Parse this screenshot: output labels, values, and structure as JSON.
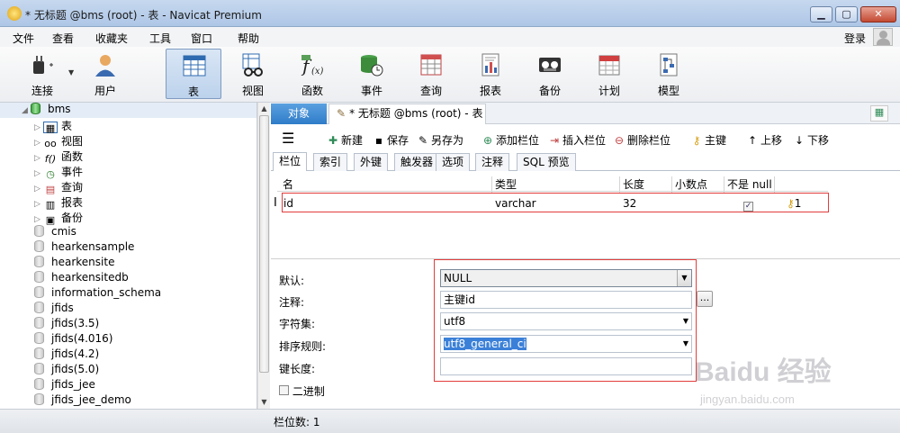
{
  "window": {
    "title": "* 无标题 @bms (root) - 表 - Navicat Premium"
  },
  "menu": {
    "items": [
      "文件",
      "查看",
      "收藏夹",
      "工具",
      "窗口",
      "帮助"
    ],
    "login": "登录"
  },
  "toolbar": {
    "buttons": [
      {
        "label": "连接",
        "icon": "plug-icon"
      },
      {
        "label": "用户",
        "icon": "user-icon"
      },
      {
        "label": "表",
        "icon": "table-icon",
        "selected": true
      },
      {
        "label": "视图",
        "icon": "view-icon"
      },
      {
        "label": "函数",
        "icon": "function-icon"
      },
      {
        "label": "事件",
        "icon": "event-icon"
      },
      {
        "label": "查询",
        "icon": "query-icon"
      },
      {
        "label": "报表",
        "icon": "report-icon"
      },
      {
        "label": "备份",
        "icon": "backup-icon"
      },
      {
        "label": "计划",
        "icon": "schedule-icon"
      },
      {
        "label": "模型",
        "icon": "model-icon"
      }
    ]
  },
  "tree": {
    "open_db": "bms",
    "children": [
      "表",
      "视图",
      "函数",
      "事件",
      "查询",
      "报表",
      "备份"
    ],
    "databases": [
      "cmis",
      "hearkensample",
      "hearkensite",
      "hearkensitedb",
      "information_schema",
      "jfids",
      "jfids(3.5)",
      "jfids(4.016)",
      "jfids(4.2)",
      "jfids(5.0)",
      "jfids_jee",
      "jfids_jee_demo"
    ]
  },
  "tabs": {
    "object": "对象",
    "doc": "* 无标题 @bms (root) - 表"
  },
  "editor_toolbar": {
    "new": "新建",
    "save": "保存",
    "save_as": "另存为",
    "add_field": "添加栏位",
    "insert_field": "插入栏位",
    "delete_field": "删除栏位",
    "primary_key": "主键",
    "move_up": "上移",
    "move_down": "下移"
  },
  "subtabs": [
    "栏位",
    "索引",
    "外键",
    "触发器",
    "选项",
    "注释",
    "SQL 预览"
  ],
  "grid": {
    "headers": [
      "名",
      "类型",
      "长度",
      "小数点",
      "不是 null"
    ],
    "rows": [
      {
        "name": "id",
        "type": "varchar",
        "length": "32",
        "decimals": "",
        "not_null": true,
        "key": "1"
      }
    ]
  },
  "props": {
    "default_label": "默认:",
    "default_value": "NULL",
    "comment_label": "注释:",
    "comment_value": "主键id",
    "charset_label": "字符集:",
    "charset_value": "utf8",
    "collation_label": "排序规则:",
    "collation_value": "utf8_general_ci",
    "keylen_label": "键长度:",
    "keylen_value": "",
    "binary_label": "二进制",
    "binary_checked": false,
    "ellipsis": "..."
  },
  "status": {
    "field_count": "栏位数: 1"
  },
  "watermark": {
    "brand": "Baidu 经验",
    "url": "jingyan.baidu.com"
  },
  "colors": {
    "accent": "#2f7cc8",
    "highlight_box": "#e23c3c",
    "selection": "#3b80d8"
  }
}
